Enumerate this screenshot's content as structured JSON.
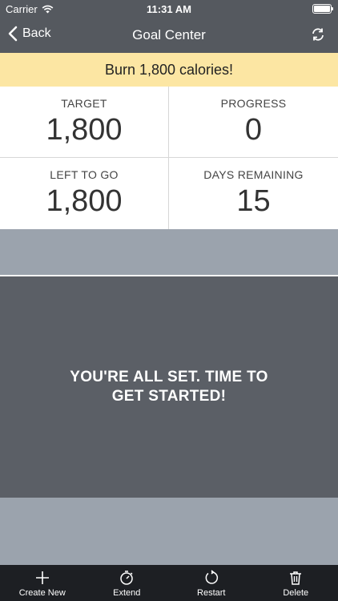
{
  "status": {
    "carrier": "Carrier",
    "time": "11:31 AM"
  },
  "nav": {
    "back_label": "Back",
    "title": "Goal Center",
    "refresh_icon": "refresh-icon"
  },
  "goal": {
    "banner": "Burn 1,800 calories!"
  },
  "stats": {
    "target": {
      "label": "TARGET",
      "value": "1,800"
    },
    "progress": {
      "label": "PROGRESS",
      "value": "0"
    },
    "left": {
      "label": "LEFT TO GO",
      "value": "1,800"
    },
    "days": {
      "label": "DAYS REMAINING",
      "value": "15"
    }
  },
  "panel": {
    "message": "YOU'RE ALL SET. TIME TO GET STARTED!"
  },
  "tabs": [
    {
      "label": "Create New",
      "icon": "plus-icon"
    },
    {
      "label": "Extend",
      "icon": "stopwatch-icon"
    },
    {
      "label": "Restart",
      "icon": "restart-icon"
    },
    {
      "label": "Delete",
      "icon": "trash-icon"
    }
  ],
  "colors": {
    "header": "#55595f",
    "banner": "#fce6a3",
    "band": "#9ba3ad",
    "panel": "#5b5f66",
    "tabbar": "#1d1f23"
  }
}
